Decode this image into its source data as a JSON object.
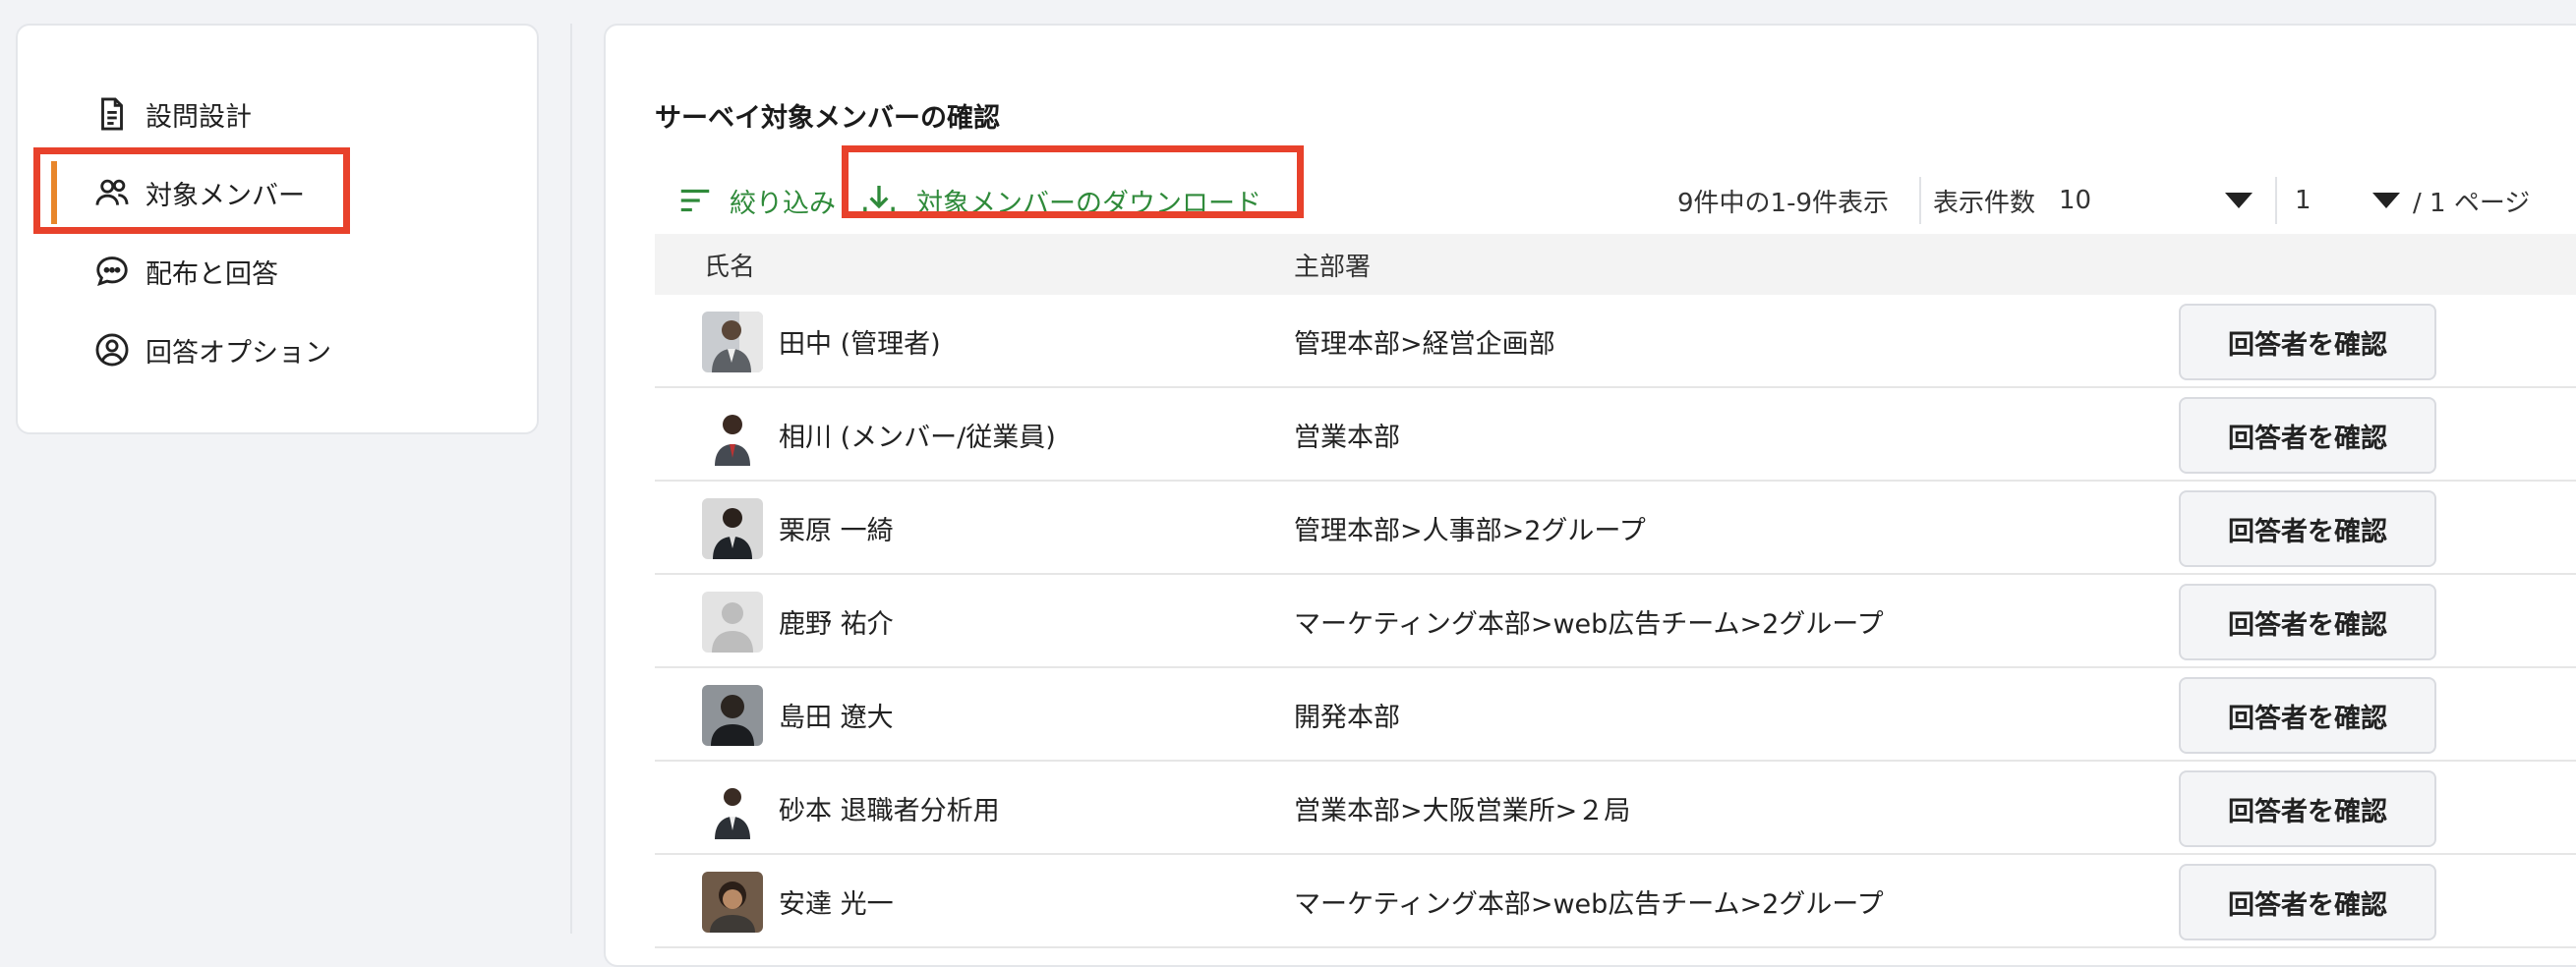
{
  "sidebar": {
    "items": [
      {
        "label": "設問設計",
        "icon": "document-icon"
      },
      {
        "label": "対象メンバー",
        "icon": "users-icon",
        "active": true
      },
      {
        "label": "配布と回答",
        "icon": "chat-bubble-icon"
      },
      {
        "label": "回答オプション",
        "icon": "user-circle-icon"
      }
    ]
  },
  "main": {
    "title": "サーベイ対象メンバーの確認",
    "toolbar": {
      "filter_label": "絞り込み",
      "download_label": "対象メンバーのダウンロード",
      "count_text": "9件中の1-9件表示",
      "per_page_label": "表示件数",
      "per_page_value": "10",
      "page_value": "1",
      "page_total": "/ 1 ページ"
    },
    "table": {
      "headers": {
        "name": "氏名",
        "dept": "主部署"
      },
      "button_label": "回答者を確認",
      "rows": [
        {
          "name": "田中 (管理者)",
          "dept": "管理本部>経営企画部"
        },
        {
          "name": "相川 (メンバー/従業員)",
          "dept": "営業本部"
        },
        {
          "name": "栗原 一綺",
          "dept": "管理本部>人事部>2グループ"
        },
        {
          "name": "鹿野 祐介",
          "dept": "マーケティング本部>web広告チーム>2グループ"
        },
        {
          "name": "島田 遼大",
          "dept": "開発本部"
        },
        {
          "name": "砂本 退職者分析用",
          "dept": "営業本部>大阪営業所>２局"
        },
        {
          "name": "安達 光一",
          "dept": "マーケティング本部>web広告チーム>2グループ"
        }
      ]
    }
  },
  "colors": {
    "accent_green": "#2f8a3a",
    "highlight_red": "#e8412b",
    "active_bar_orange": "#e8862b"
  }
}
